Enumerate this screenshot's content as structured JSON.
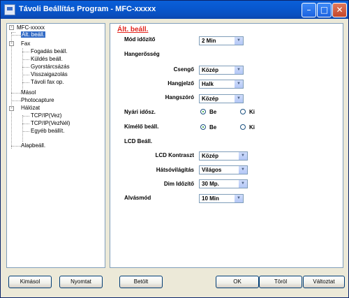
{
  "window": {
    "title": "Távoli Beállítás Program - MFC-xxxxx"
  },
  "tree": {
    "root": "MFC-xxxxx",
    "items": [
      {
        "label": "Ált. beáll.",
        "selected": true
      },
      {
        "label": "Fax"
      },
      {
        "label": "Fogadás beáll."
      },
      {
        "label": "Küldés beáll."
      },
      {
        "label": "Gyorstárcsázás"
      },
      {
        "label": "Visszaigazolás"
      },
      {
        "label": "Távoli fax op."
      },
      {
        "label": "Másol"
      },
      {
        "label": "Photocapture"
      },
      {
        "label": "Hálózat"
      },
      {
        "label": "TCP/IP(Vez)"
      },
      {
        "label": "TCP/IP(VezNél)"
      },
      {
        "label": "Egyéb beállít."
      },
      {
        "label": "Alapbeáll."
      }
    ]
  },
  "panel": {
    "title": "Ált. beáll.",
    "mode_timer": {
      "label": "Mód időzítő",
      "value": "2 Min"
    },
    "volume_header": "Hangerősség",
    "ring": {
      "label": "Csengő",
      "value": "Közép"
    },
    "beeper": {
      "label": "Hangjelző",
      "value": "Halk"
    },
    "speaker": {
      "label": "Hangszóró",
      "value": "Közép"
    },
    "dst": {
      "label": "Nyári idősz.",
      "on": "Be",
      "off": "Ki",
      "selected": "Be"
    },
    "toner_save": {
      "label": "Kímélő beáll.",
      "on": "Be",
      "off": "Ki",
      "selected": "Be"
    },
    "lcd_header": "LCD Beáll.",
    "lcd_contrast": {
      "label": "LCD Kontraszt",
      "value": "Közép"
    },
    "backlight": {
      "label": "Hátsóvilágítás",
      "value": "Világos"
    },
    "dim_timer": {
      "label": "Dim Időzítő",
      "value": "30 Mp."
    },
    "sleep_mode": {
      "label": "Alvásmód",
      "value": "10 Min"
    }
  },
  "buttons": {
    "export": "Kimásol",
    "print": "Nyomtat",
    "import": "Betölt",
    "ok": "OK",
    "cancel": "Töröl",
    "apply": "Változtat"
  }
}
